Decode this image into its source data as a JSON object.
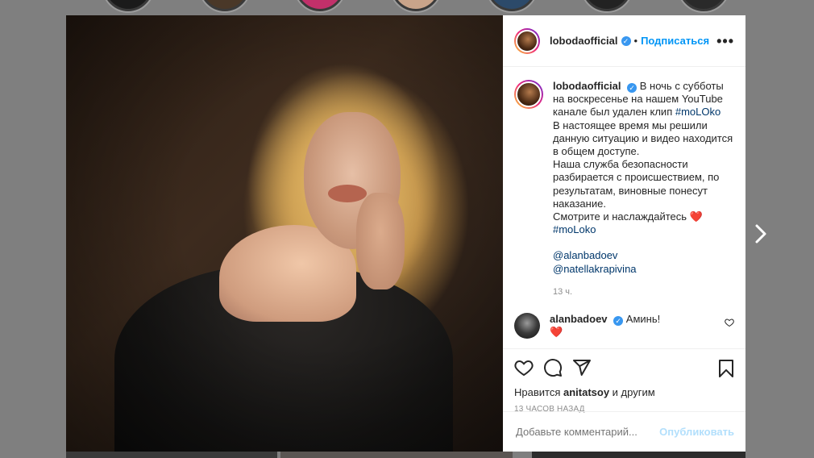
{
  "post": {
    "username": "lobodaofficial",
    "verified_badge": "✓",
    "separator": "•",
    "follow_label": "Подписаться",
    "more_label": "•••",
    "caption": {
      "line1": "В ночь с субботы на воскресенье на нашем YouTube канале был удален клип ",
      "hashtag1": "#moLOko",
      "line2": "В настоящее время мы решили данную ситуацию и видео находится в общем доступе.",
      "line3": "Наша служба безопасности разбирается с происшествием, по результатам, виновные понесут наказание.",
      "line4": "Смотрите и наслаждайтесь ",
      "heart": "❤️",
      "hashtag2": "#moLoko",
      "mention1": "@alanbadoev",
      "mention2": "@natellakrapivina"
    },
    "caption_time": "13 ч.",
    "comment": {
      "username": "alanbadoev",
      "text": "Аминь!",
      "emoji": "❤️"
    },
    "likes": {
      "prefix": "Нравится ",
      "user": "anitatsoy",
      "suffix": " и другим"
    },
    "posted_ago": "13 ЧАСОВ НАЗАД",
    "comment_placeholder": "Добавьте комментарий...",
    "publish_label": "Опубликовать"
  },
  "icons": {
    "like": "heart-icon",
    "comment": "comment-icon",
    "share": "share-icon",
    "save": "bookmark-icon",
    "next": "chevron-right-icon"
  },
  "colors": {
    "accent": "#0095f6",
    "publish_disabled": "#b2dffc",
    "verified": "#3897f0"
  }
}
